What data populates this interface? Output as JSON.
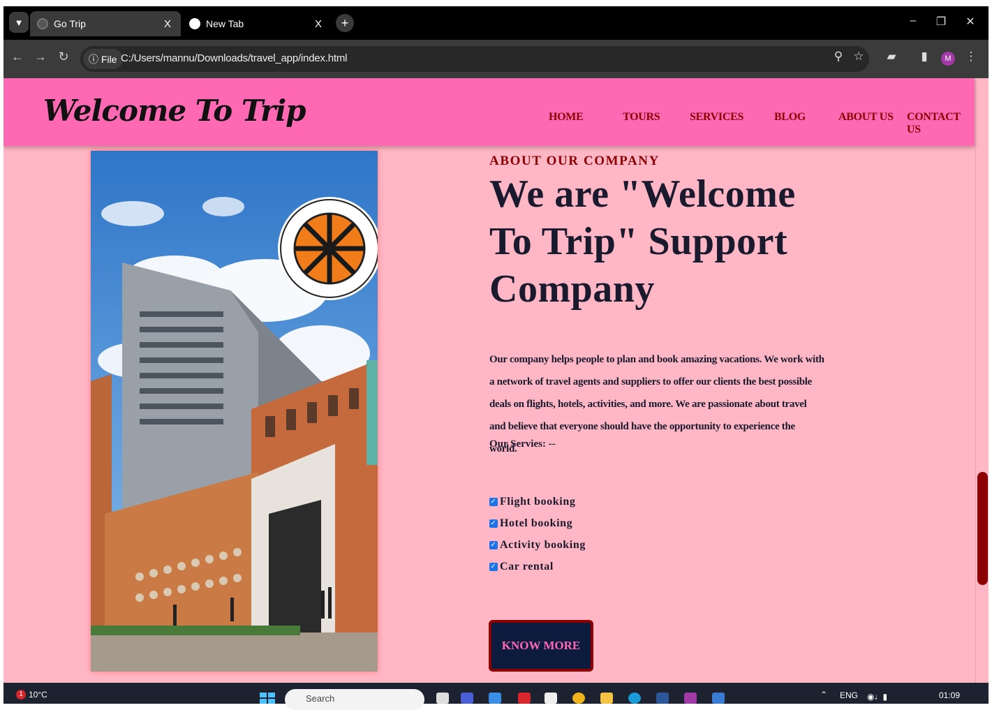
{
  "browser": {
    "tabs": [
      {
        "title": "Go Trip",
        "active": true
      },
      {
        "title": "New Tab",
        "active": false
      }
    ],
    "close_glyph": "X",
    "new_tab_glyph": "+",
    "address": {
      "security_label": "File",
      "url": "C:/Users/mannu/Downloads/travel_app/index.html"
    },
    "avatar_letter": "M",
    "icons": [
      "tab-search-icon",
      "back-icon",
      "forward-icon",
      "reload-icon",
      "info-icon",
      "zoom-icon",
      "bookmark-star-icon",
      "extensions-icon",
      "side-panel-icon",
      "menu-kebab-icon",
      "minimize-icon",
      "restore-icon",
      "close-window-icon"
    ]
  },
  "site": {
    "logo": "Welcome To Trip",
    "nav": [
      "HOME",
      "TOURS",
      "SERVICES",
      "BLOG",
      "ABOUT US",
      "CONTACT US"
    ],
    "colors": {
      "header_bg": "#ff69b4",
      "page_bg": "#ffb7c5",
      "accent": "#8b0000",
      "button_bg": "#0d1b3e",
      "button_text": "#ff69b4"
    }
  },
  "about": {
    "kicker": "ABOUT OUR COMPANY",
    "title": "We are \"Welcome To Trip\" Support Company",
    "body": "Our company helps people to plan and book amazing vacations. We work with a network of travel agents and suppliers to offer our clients the best possible deals on flights, hotels, activities, and more. We are passionate about travel and believe that everyone should have the opportunity to experience the world.",
    "services_label": "Our Servies: --",
    "services": [
      {
        "label": "Flight booking",
        "checked": true
      },
      {
        "label": "Hotel booking",
        "checked": true
      },
      {
        "label": "Activity booking",
        "checked": true
      },
      {
        "label": "Car rental",
        "checked": true
      }
    ],
    "cta": "KNOW MORE"
  },
  "taskbar": {
    "weather": "10°C",
    "weather_badge": "1",
    "search_placeholder": "Search",
    "language": "ENG",
    "time": "01:09"
  }
}
